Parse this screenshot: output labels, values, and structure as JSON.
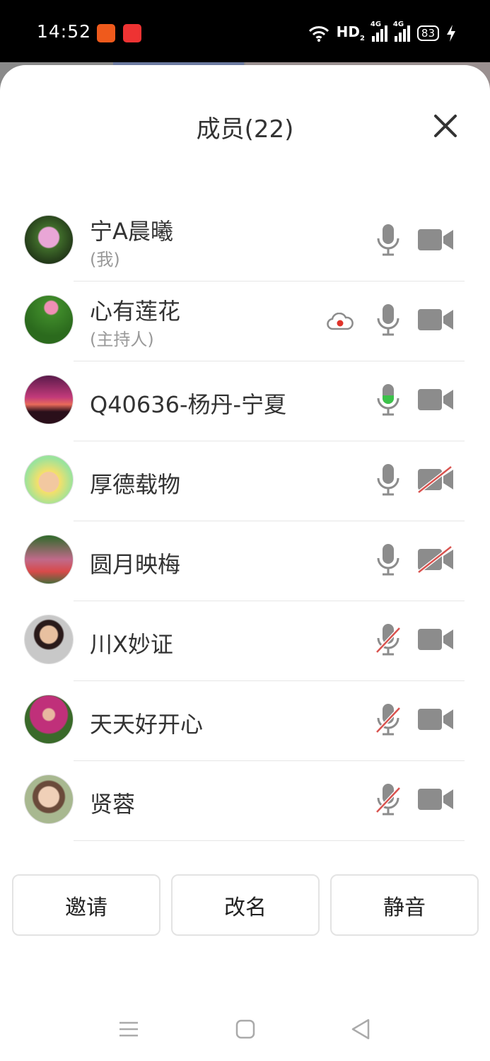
{
  "status_bar": {
    "time": "14:52",
    "hd_label": "HD",
    "hd_sub": "2",
    "net1": "4G",
    "net2": "4G",
    "battery": "83",
    "icons": [
      "app-icon",
      "app-icon",
      "wifi-icon",
      "signal-icon",
      "signal-icon",
      "battery-icon",
      "charging-icon"
    ]
  },
  "sheet": {
    "title": "成员(22)",
    "close_icon": "close-icon"
  },
  "members": [
    {
      "name": "宁A晨曦",
      "sub": "(我)",
      "mic": "on",
      "camera": "on"
    },
    {
      "name": "心有莲花",
      "sub": "(主持人)",
      "mic": "on",
      "camera": "on",
      "recording": true
    },
    {
      "name": "Q40636-杨丹-宁夏",
      "mic": "speaking",
      "camera": "on"
    },
    {
      "name": "厚德载物",
      "mic": "on",
      "camera": "off"
    },
    {
      "name": "圆月映梅",
      "mic": "on",
      "camera": "off"
    },
    {
      "name": "川X妙证",
      "mic": "muted",
      "camera": "on"
    },
    {
      "name": "天天好开心",
      "mic": "muted",
      "camera": "on"
    },
    {
      "name": "贤蓉",
      "mic": "muted",
      "camera": "on"
    }
  ],
  "actions": {
    "invite": "邀请",
    "rename": "改名",
    "mute": "静音"
  },
  "colors": {
    "icon_gray": "#8c8c8c",
    "speaking_green": "#3cc24a",
    "muted_red": "#d9534f",
    "record_red": "#e0332a"
  },
  "nav_bar": [
    "menu-icon",
    "home-icon",
    "back-icon"
  ]
}
